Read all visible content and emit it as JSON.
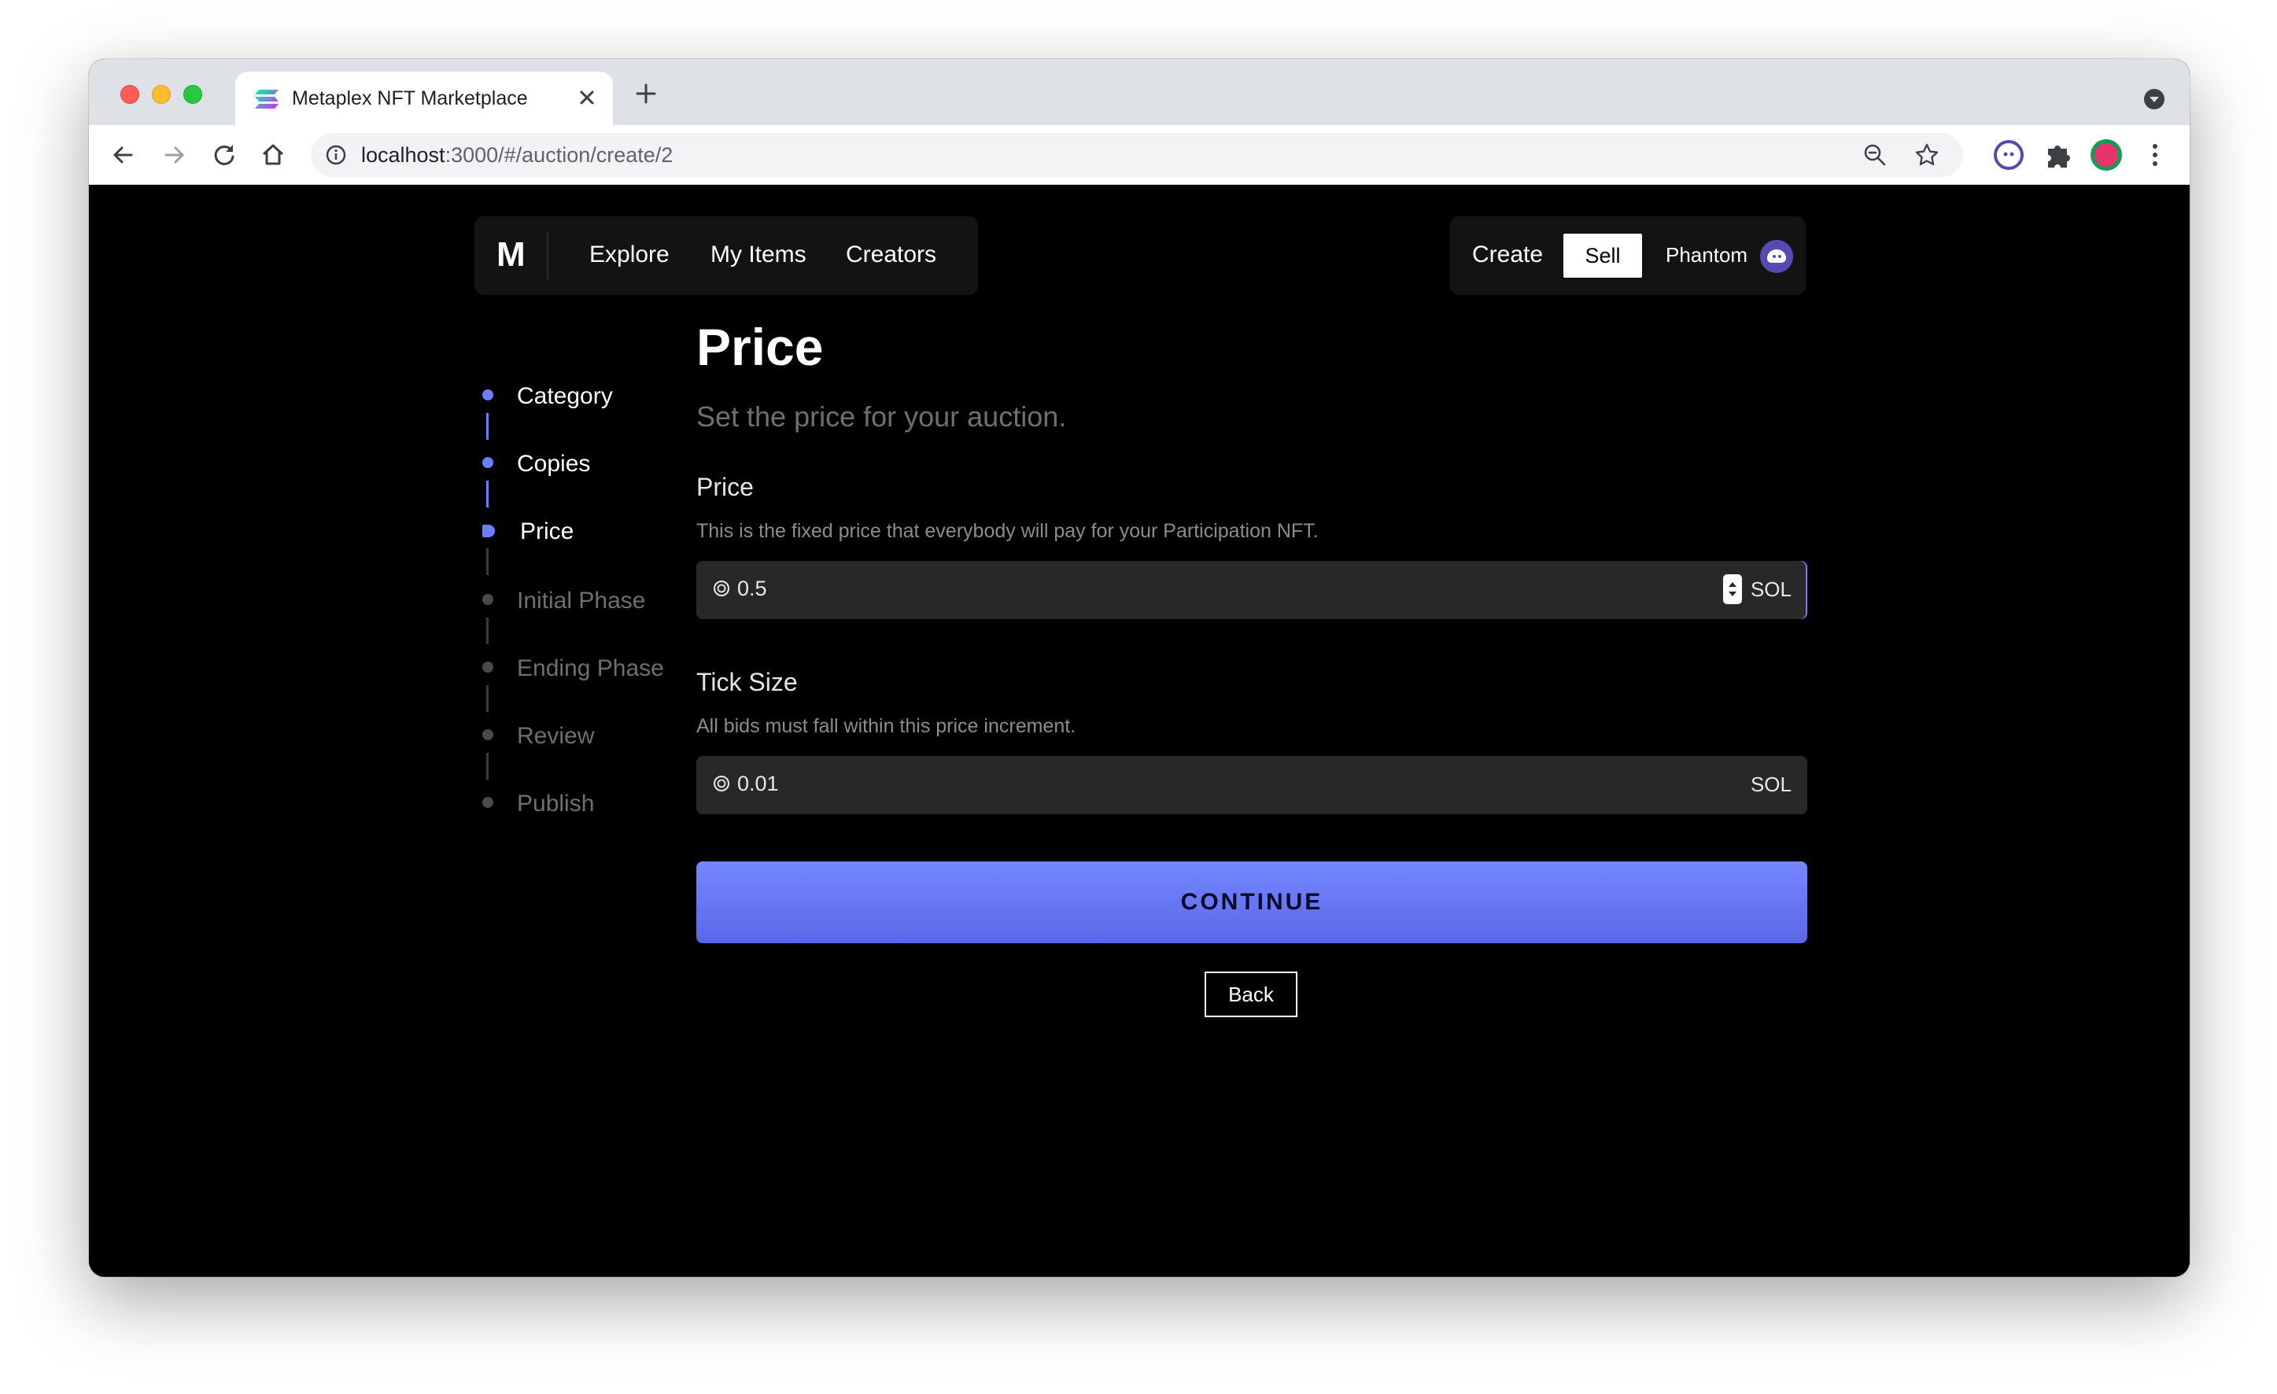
{
  "browser": {
    "tab_title": "Metaplex NFT Marketplace",
    "url_host": "localhost",
    "url_path": ":3000/#/auction/create/2"
  },
  "nav": {
    "logo": "M",
    "links": [
      "Explore",
      "My Items",
      "Creators"
    ],
    "create": "Create",
    "sell": "Sell",
    "wallet": "Phantom"
  },
  "steps": [
    {
      "label": "Category",
      "state": "done"
    },
    {
      "label": "Copies",
      "state": "done"
    },
    {
      "label": "Price",
      "state": "active"
    },
    {
      "label": "Initial Phase",
      "state": "todo"
    },
    {
      "label": "Ending Phase",
      "state": "todo"
    },
    {
      "label": "Review",
      "state": "todo"
    },
    {
      "label": "Publish",
      "state": "todo"
    }
  ],
  "form": {
    "title": "Price",
    "subtitle": "Set the price for your auction.",
    "price": {
      "label": "Price",
      "help": "This is the fixed price that everybody will pay for your Participation NFT.",
      "value": "0.5",
      "unit": "SOL"
    },
    "tick": {
      "label": "Tick Size",
      "help": "All bids must fall within this price increment.",
      "value": "0.01",
      "unit": "SOL"
    },
    "continue": "CONTINUE",
    "back": "Back"
  },
  "colors": {
    "accent": "#6e7dff",
    "background": "#000000",
    "panel": "#131313",
    "input": "#282828"
  }
}
